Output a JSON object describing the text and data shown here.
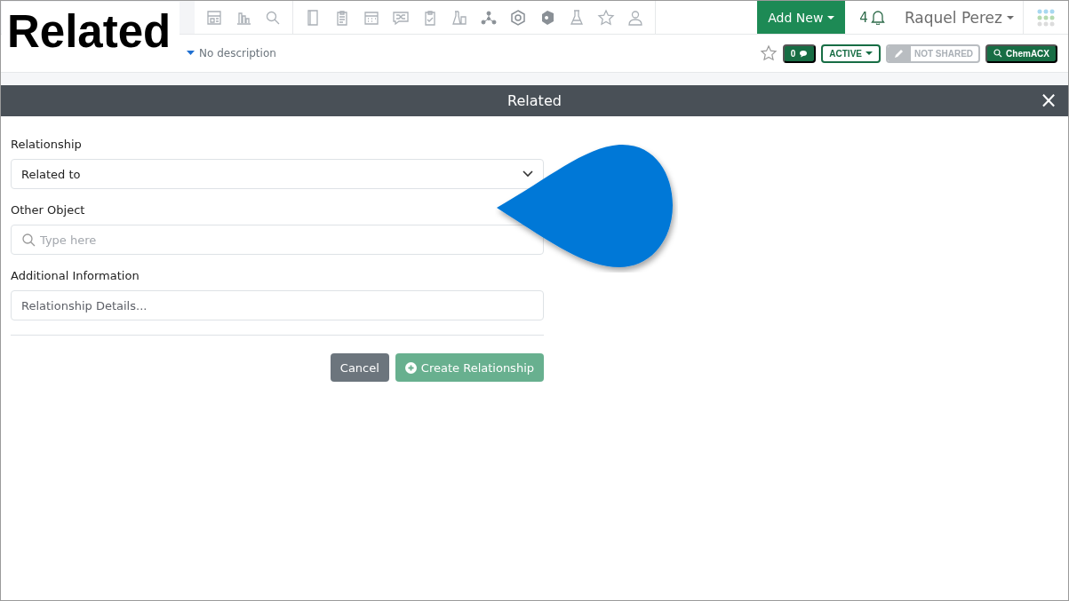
{
  "caption": "Related",
  "header": {
    "add_new": "Add New",
    "notifications": "4",
    "user": "Raquel Perez"
  },
  "subheader": {
    "description": "No description",
    "favorite": false,
    "comments": "0",
    "status": "ACTIVE",
    "sharing": "NOT SHARED",
    "search_button": "ChemACX"
  },
  "dialog": {
    "title": "Related",
    "close": "×",
    "fields": [
      {
        "kind": "select",
        "label": "Relationship",
        "value": "Related to"
      },
      {
        "kind": "search",
        "label": "Other Object",
        "placeholder": "Type here"
      },
      {
        "kind": "text",
        "label": "Additional Information",
        "placeholder": "Relationship Details..."
      }
    ],
    "buttons": [
      {
        "label": "Cancel",
        "kind": "secondary",
        "disabled": false
      },
      {
        "label": "Create Relationship",
        "kind": "primary",
        "disabled": true
      }
    ]
  }
}
